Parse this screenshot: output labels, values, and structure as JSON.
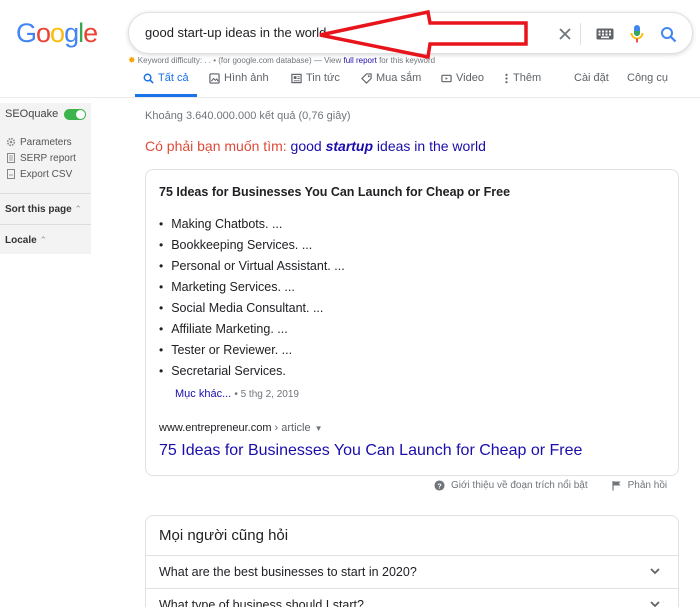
{
  "logo": {
    "letters": [
      "G",
      "o",
      "o",
      "g",
      "l",
      "e"
    ],
    "colors": [
      "#4285f4",
      "#ea4335",
      "#fbbc05",
      "#4285f4",
      "#34a853",
      "#ea4335"
    ]
  },
  "search": {
    "value": "good start-up ideas in the world"
  },
  "seoquake_line": {
    "prefix": "Keyword difficulty: . . •  (for google.com database) — View ",
    "link": "full report",
    "suffix": " for this keyword"
  },
  "tabs": [
    {
      "label": "Tất cả",
      "icon": "search-icon",
      "active": true
    },
    {
      "label": "Hình ảnh",
      "icon": "image-icon"
    },
    {
      "label": "Tin tức",
      "icon": "news-icon"
    },
    {
      "label": "Mua sắm",
      "icon": "tag-icon"
    },
    {
      "label": "Video",
      "icon": "video-icon"
    },
    {
      "label": "Thêm",
      "icon": "more-vert-icon"
    },
    {
      "label": "Cài đặt"
    },
    {
      "label": "Công cụ"
    }
  ],
  "sidebar": {
    "title": "SEOquake",
    "items": [
      "Parameters",
      "SERP report",
      "Export CSV"
    ],
    "sort_label": "Sort this page",
    "locale_label": "Locale"
  },
  "result_stats": "Khoảng 3.640.000.000 kết quả (0,76 giây)",
  "did_you_mean": {
    "prefix": "Có phải bạn muốn tìm: ",
    "part1": "good ",
    "bold": "startup",
    "part2": " ideas in the world"
  },
  "snippet": {
    "title": "75 Ideas for Businesses You Can Launch for Cheap or Free",
    "items": [
      "Making Chatbots. ...",
      "Bookkeeping Services. ...",
      "Personal or Virtual Assistant. ...",
      "Marketing Services. ...",
      "Social Media Consultant. ...",
      "Affiliate Marketing. ...",
      "Tester or Reviewer. ...",
      "Secretarial Services."
    ],
    "more_label": "Mục khác...",
    "date": "• 5 thg 2, 2019",
    "cite_domain": "www.entrepreneur.com",
    "cite_path": " › article",
    "link_title": "75 Ideas for Businesses You Can Launch for Cheap or Free"
  },
  "feedback": {
    "about": "Giới thiệu về đoạn trích nổi bật",
    "report": "Phản hồi"
  },
  "paa": {
    "title": "Mọi người cũng hỏi",
    "questions": [
      "What are the best businesses to start in 2020?",
      "What type of business should I start?"
    ]
  },
  "colors": {
    "accent": "#1a73e8",
    "link": "#1a0dab",
    "annotation": "#e8141c",
    "seoquake_green": "#3cb44b"
  }
}
